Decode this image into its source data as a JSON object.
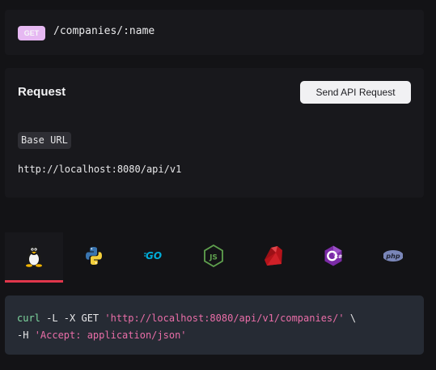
{
  "endpoint": {
    "method": "GET",
    "path": "/companies/:name",
    "method_color": "#e6b8f2"
  },
  "request": {
    "title": "Request",
    "send_label": "Send API Request",
    "base_url_label": "Base URL",
    "base_url": "http://localhost:8080/api/v1"
  },
  "tabs": [
    {
      "icon": "linux-tux-icon",
      "active": true
    },
    {
      "icon": "python-icon",
      "active": false
    },
    {
      "icon": "go-icon",
      "label": "GO",
      "active": false
    },
    {
      "icon": "nodejs-icon",
      "label": "JS",
      "active": false
    },
    {
      "icon": "ruby-icon",
      "active": false
    },
    {
      "icon": "csharp-icon",
      "label": "C#",
      "active": false
    },
    {
      "icon": "php-icon",
      "label": "php",
      "active": false
    }
  ],
  "code": {
    "line1_cmd": "curl",
    "line1_flags": " -L -X GET ",
    "line1_url": "'http://localhost:8080/api/v1/companies/'",
    "line1_end": " \\",
    "line2_flag": "-H ",
    "line2_header": "'Accept: application/json'"
  },
  "colors": {
    "accent_tab": "#e0374b",
    "code_bg": "#262b34",
    "string": "#ea6ea8",
    "command": "#7fd8a0"
  }
}
